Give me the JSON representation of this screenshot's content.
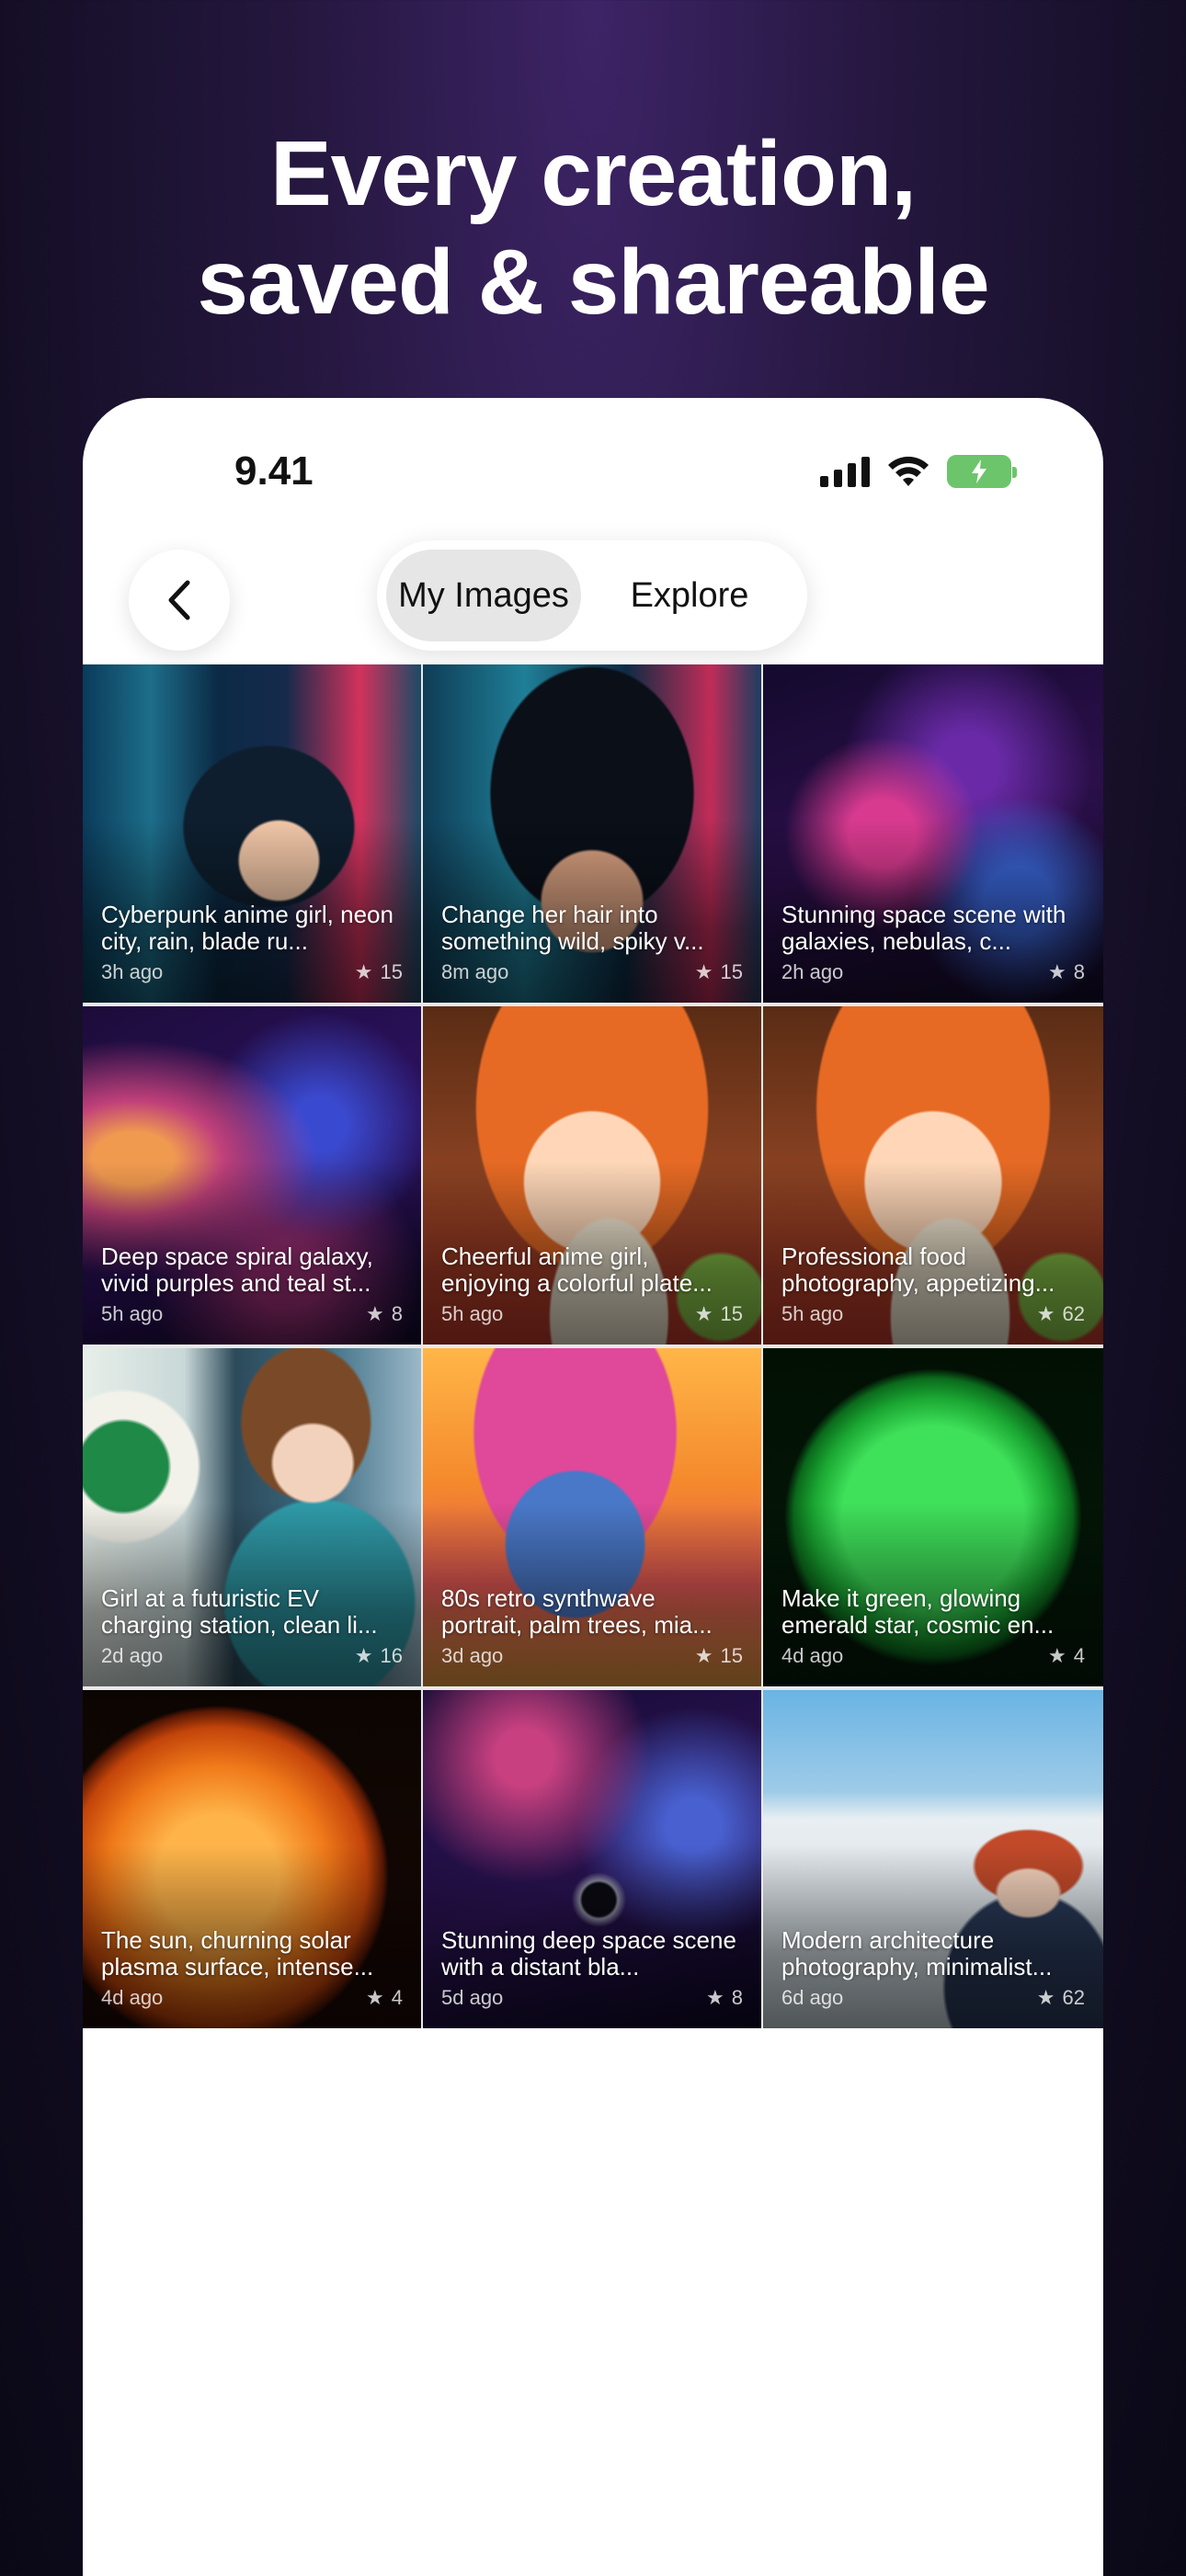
{
  "headline": {
    "line1": "Every creation,",
    "line2": "saved & shareable"
  },
  "status": {
    "time": "9.41"
  },
  "tabs": {
    "active": "My Images",
    "other": "Explore"
  },
  "images": [
    {
      "prompt": "Cyberpunk anime girl, neon city, rain, blade ru...",
      "age": "3h ago",
      "stars": "15",
      "art": "cyber-girl"
    },
    {
      "prompt": "Change her hair into something wild, spiky v...",
      "age": "8m ago",
      "stars": "15",
      "art": "spiky-hair"
    },
    {
      "prompt": "Stunning space scene with galaxies, nebulas, c...",
      "age": "2h ago",
      "stars": "8",
      "art": "space"
    },
    {
      "prompt": "Deep space spiral galaxy, vivid purples and teal st...",
      "age": "5h ago",
      "stars": "8",
      "art": "galaxy"
    },
    {
      "prompt": "Cheerful anime girl, enjoying a colorful plate...",
      "age": "5h ago",
      "stars": "15",
      "art": "anime-food"
    },
    {
      "prompt": "Professional food photography, appetizing...",
      "age": "5h ago",
      "stars": "62",
      "art": "anime-food"
    },
    {
      "prompt": "Girl at a futuristic EV charging station, clean li...",
      "age": "2d ago",
      "stars": "16",
      "art": "ev-girl"
    },
    {
      "prompt": "80s retro synthwave portrait, palm trees, mia...",
      "age": "3d ago",
      "stars": "15",
      "art": "synthwave"
    },
    {
      "prompt": "Make it green, glowing emerald star, cosmic en...",
      "age": "4d ago",
      "stars": "4",
      "art": "green-star"
    },
    {
      "prompt": "The sun, churning solar plasma surface, intense...",
      "age": "4d ago",
      "stars": "4",
      "art": "sun"
    },
    {
      "prompt": "Stunning deep space scene with a distant bla...",
      "age": "5d ago",
      "stars": "8",
      "art": "deep-space"
    },
    {
      "prompt": "Modern architecture photography, minimalist...",
      "age": "6d ago",
      "stars": "62",
      "art": "architecture"
    }
  ]
}
